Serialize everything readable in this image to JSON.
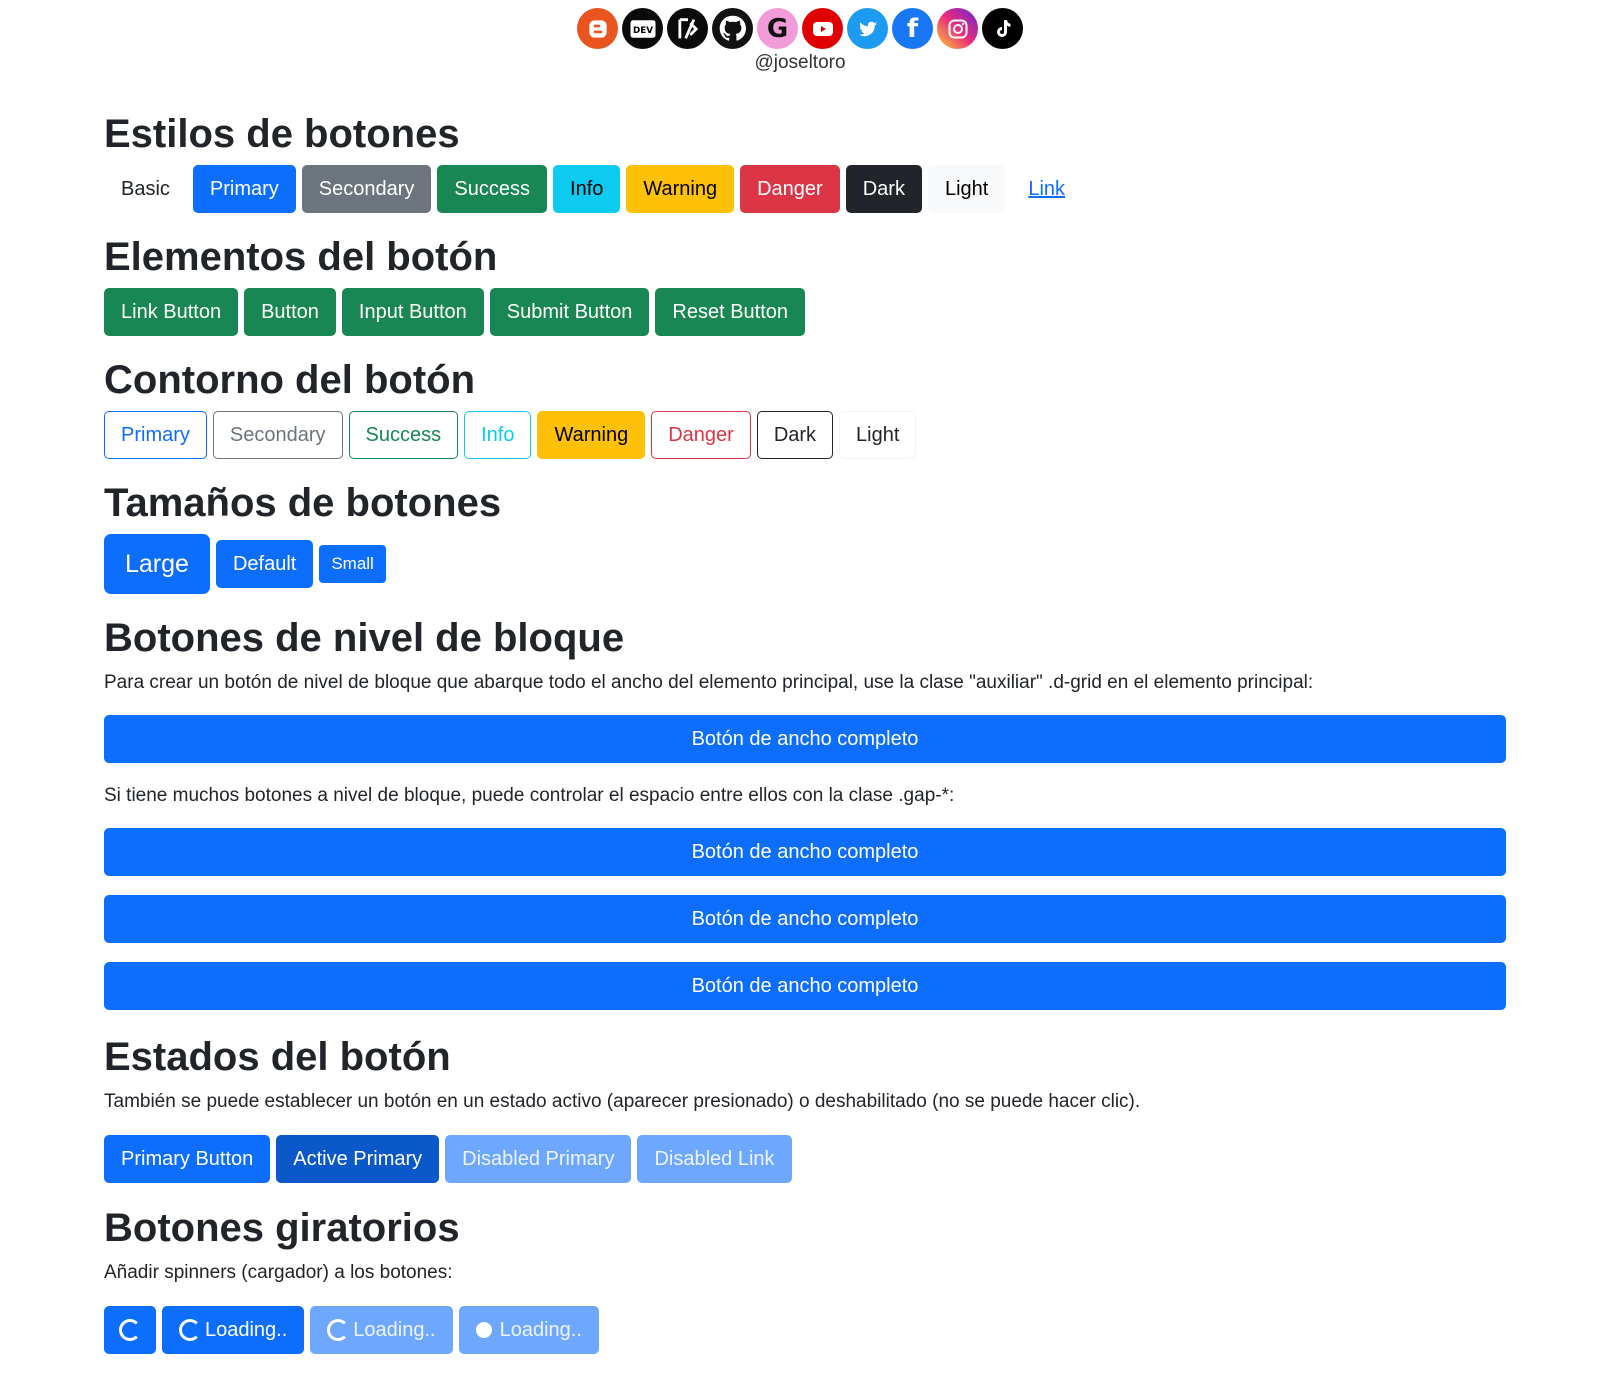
{
  "header": {
    "icons": [
      "blogger-icon",
      "dev-icon",
      "devto-slash-icon",
      "github-icon",
      "google-icon",
      "youtube-icon",
      "twitter-icon",
      "facebook-icon",
      "instagram-icon",
      "tiktok-icon"
    ],
    "handle": "@joseltoro"
  },
  "estilos": {
    "title": "Estilos de botones",
    "buttons": [
      "Basic",
      "Primary",
      "Secondary",
      "Success",
      "Info",
      "Warning",
      "Danger",
      "Dark",
      "Light",
      "Link"
    ]
  },
  "elementos": {
    "title": "Elementos del botón",
    "buttons": [
      "Link Button",
      "Button",
      "Input Button",
      "Submit Button",
      "Reset Button"
    ]
  },
  "contorno": {
    "title": "Contorno del botón",
    "buttons": [
      "Primary",
      "Secondary",
      "Success",
      "Info",
      "Warning",
      "Danger",
      "Dark",
      "Light"
    ]
  },
  "tamanos": {
    "title": "Tamaños de botones",
    "buttons": [
      "Large",
      "Default",
      "Small"
    ]
  },
  "bloque": {
    "title": "Botones de nivel de bloque",
    "text1": "Para crear un botón de nivel de bloque que abarque todo el ancho del elemento principal, use la clase \"auxiliar\" .d-grid en el elemento principal:",
    "button_label": "Botón de ancho completo",
    "text2": "Si tiene muchos botones a nivel de bloque, puede controlar el espacio entre ellos con la clase .gap-*:"
  },
  "estados": {
    "title": "Estados del botón",
    "text": "También se puede establecer un botón en un estado activo (aparecer presionado) o deshabilitado (no se puede hacer clic).",
    "buttons": [
      "Primary Button",
      "Active Primary",
      "Disabled Primary",
      "Disabled Link"
    ]
  },
  "giratorios": {
    "title": "Botones giratorios",
    "text": "Añadir spinners (cargador) a los botones:",
    "loading_label": "Loading.."
  },
  "colors": {
    "primary": "#0d6efd",
    "secondary": "#6c757d",
    "success": "#198754",
    "info": "#0dcaf0",
    "warning": "#ffc107",
    "danger": "#dc3545",
    "dark": "#212529"
  }
}
